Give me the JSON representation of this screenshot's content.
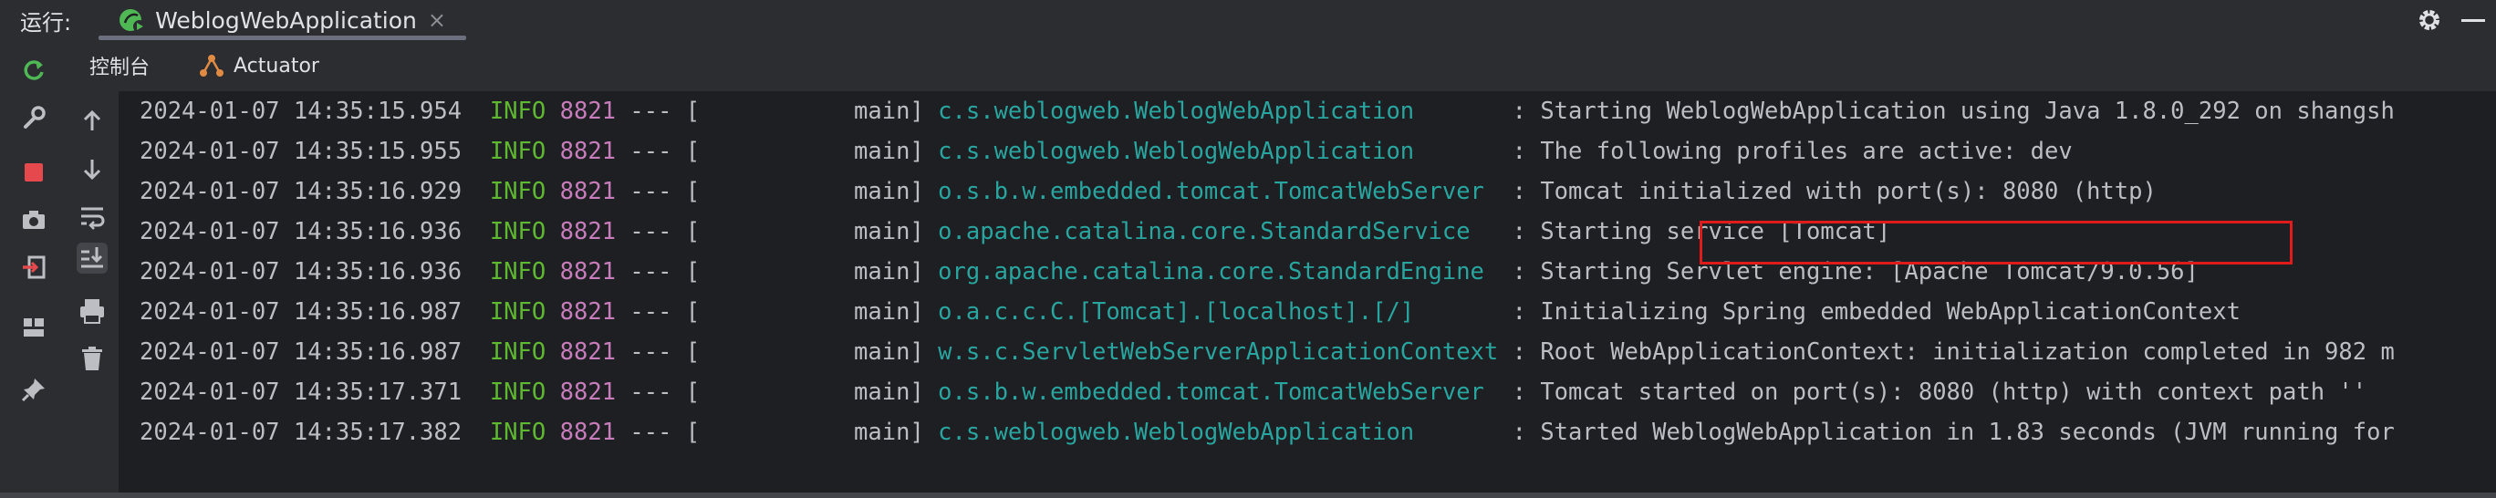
{
  "run_bar": {
    "label": "运行:",
    "tab_title": "WeblogWebApplication",
    "tab_close": "×"
  },
  "sub_toolbar": {
    "console_tab": "控制台",
    "actuator_tab": "Actuator"
  },
  "log": {
    "separator": " --- [",
    "lines": [
      {
        "ts": "2024-01-07 14:35:15.954",
        "level": "INFO",
        "pid": "8821",
        "thread": "main]",
        "logger": "c.s.weblogweb.WeblogWebApplication      ",
        "message": ": Starting WeblogWebApplication using Java 1.8.0_292 on shangsh"
      },
      {
        "ts": "2024-01-07 14:35:15.955",
        "level": "INFO",
        "pid": "8821",
        "thread": "main]",
        "logger": "c.s.weblogweb.WeblogWebApplication      ",
        "message": ": The following profiles are active: dev"
      },
      {
        "ts": "2024-01-07 14:35:16.929",
        "level": "INFO",
        "pid": "8821",
        "thread": "main]",
        "logger": "o.s.b.w.embedded.tomcat.TomcatWebServer ",
        "message": ": Tomcat initialized with port(s): 8080 (http)"
      },
      {
        "ts": "2024-01-07 14:35:16.936",
        "level": "INFO",
        "pid": "8821",
        "thread": "main]",
        "logger": "o.apache.catalina.core.StandardService  ",
        "message": ": Starting service [Tomcat]"
      },
      {
        "ts": "2024-01-07 14:35:16.936",
        "level": "INFO",
        "pid": "8821",
        "thread": "main]",
        "logger": "org.apache.catalina.core.StandardEngine ",
        "message": ": Starting Servlet engine: [Apache Tomcat/9.0.56]"
      },
      {
        "ts": "2024-01-07 14:35:16.987",
        "level": "INFO",
        "pid": "8821",
        "thread": "main]",
        "logger": "o.a.c.c.C.[Tomcat].[localhost].[/]      ",
        "message": ": Initializing Spring embedded WebApplicationContext"
      },
      {
        "ts": "2024-01-07 14:35:16.987",
        "level": "INFO",
        "pid": "8821",
        "thread": "main]",
        "logger": "w.s.c.ServletWebServerApplicationContext",
        "message": ": Root WebApplicationContext: initialization completed in 982 m"
      },
      {
        "ts": "2024-01-07 14:35:17.371",
        "level": "INFO",
        "pid": "8821",
        "thread": "main]",
        "logger": "o.s.b.w.embedded.tomcat.TomcatWebServer ",
        "message": ": Tomcat started on port(s): 8080 (http) with context path ''"
      },
      {
        "ts": "2024-01-07 14:35:17.382",
        "level": "INFO",
        "pid": "8821",
        "thread": "main]",
        "logger": "c.s.weblogweb.WeblogWebApplication      ",
        "message": ": Started WeblogWebApplication in 1.83 seconds (JVM running for"
      }
    ]
  },
  "colors": {
    "level_info": "#5fb832",
    "pid": "#c77dbb",
    "logger": "#29a5a0",
    "highlight_box": "#e01b1b",
    "rerun_green": "#4fb854",
    "stop_red": "#e5484d"
  },
  "icons": {
    "run_tab": "spring-run-icon",
    "settings": "gear-icon",
    "minimize": "minimize-icon",
    "actuator": "actuator-icon",
    "left_toolbar": [
      "rerun-icon",
      "wrench-icon",
      "stop-icon",
      "camera-icon",
      "exit-icon",
      "layout-icon",
      "pin-icon"
    ],
    "console_toolbar": [
      "arrow-up-icon",
      "arrow-down-icon",
      "soft-wrap-icon",
      "scroll-to-end-icon",
      "print-icon",
      "trash-icon"
    ]
  }
}
